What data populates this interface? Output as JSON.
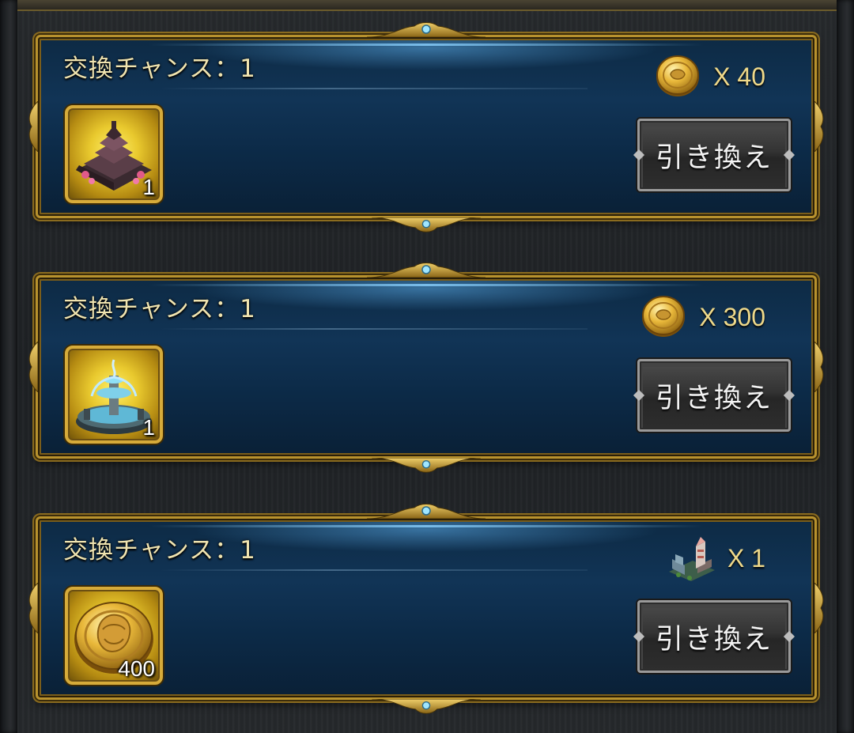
{
  "exchanges": [
    {
      "title": "交換チャンス：1",
      "cost_icon": "gold-coin-icon",
      "cost_text": "X 40",
      "item_icon": "dark-palace-building-icon",
      "item_qty": "1",
      "button_label": "引き換え"
    },
    {
      "title": "交換チャンス：1",
      "cost_icon": "gold-coin-icon",
      "cost_text": "X 300",
      "item_icon": "fountain-building-icon",
      "item_qty": "1",
      "button_label": "引き換え"
    },
    {
      "title": "交換チャンス：1",
      "cost_icon": "tower-city-icon",
      "cost_text": "X 1",
      "item_icon": "gold-coin-icon",
      "item_qty": "400",
      "button_label": "引き換え"
    }
  ],
  "colors": {
    "gold_frame": "#b8922e",
    "panel_blue": "#113456",
    "title_text": "#f0e4b0",
    "cost_text": "#efd98a"
  }
}
